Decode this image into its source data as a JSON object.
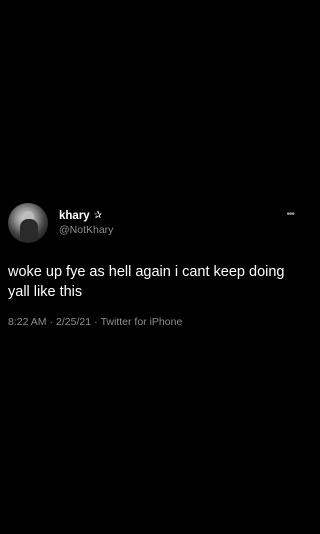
{
  "tweet": {
    "display_name": "khary",
    "badge_icon": "star-outline-icon",
    "badge_glyph": "✰",
    "handle": "@NotKhary",
    "more_glyph": "•••",
    "text": "woke up fye as hell again i cant keep doing yall like this",
    "time": "8:22 AM",
    "separator1": "·",
    "date": "2/25/21",
    "separator2": "·",
    "source": "Twitter for iPhone"
  },
  "colors": {
    "background": "#000000",
    "primary_text": "#ffffff",
    "secondary_text": "#8b8f93"
  }
}
